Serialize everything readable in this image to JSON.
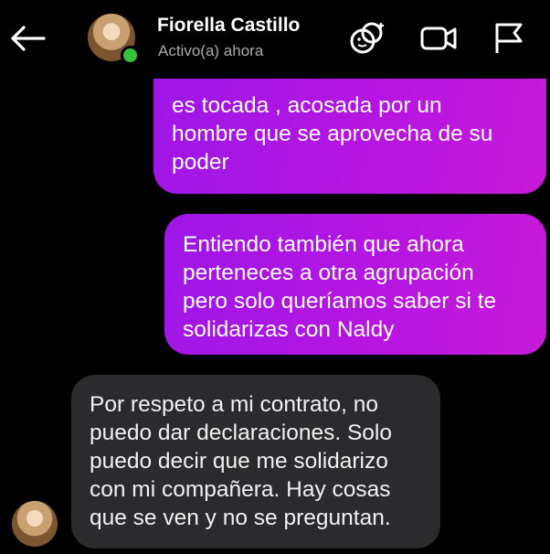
{
  "header": {
    "contact_name": "Fiorella Castillo",
    "status": "Activo(a) ahora",
    "icons": [
      "back-arrow-icon",
      "effects-icon",
      "video-call-icon",
      "flag-icon"
    ]
  },
  "messages": [
    {
      "direction": "outgoing",
      "lines": [
        "es tocada , acosada por un",
        "hombre que se aprovecha de su",
        "poder"
      ]
    },
    {
      "direction": "outgoing",
      "lines": [
        "Entiendo también que ahora",
        "perteneces a otra agrupación",
        "pero solo queríamos saber si te",
        "solidarizas con Naldy"
      ]
    },
    {
      "direction": "incoming",
      "lines": [
        "Por respeto a mi contrato, no",
        "puedo dar declaraciones. Solo",
        "puedo decir que me solidarizo",
        "con mi compañera. Hay cosas",
        "que se ven y no se preguntan."
      ]
    }
  ],
  "colors": {
    "outgoing_bubble": "#b515e2",
    "incoming_bubble": "#2b2b2d",
    "online_dot": "#35c33c"
  }
}
